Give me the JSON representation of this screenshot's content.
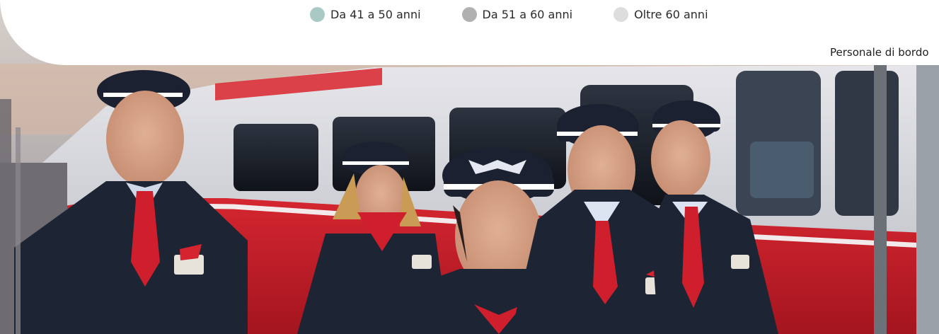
{
  "legend": {
    "items": [
      {
        "label": "Da 41 a 50 anni",
        "color": "#a9cac4"
      },
      {
        "label": "Da 51 a 60 anni",
        "color": "#b0b0b0"
      },
      {
        "label": "Oltre 60 anni",
        "color": "#dddddd"
      }
    ]
  },
  "section": {
    "role_label": "Personale di bordo"
  },
  "photo": {
    "subject": "train-staff-photo",
    "accent_red": "#cf1f2c",
    "uniform_navy": "#1d2434"
  }
}
